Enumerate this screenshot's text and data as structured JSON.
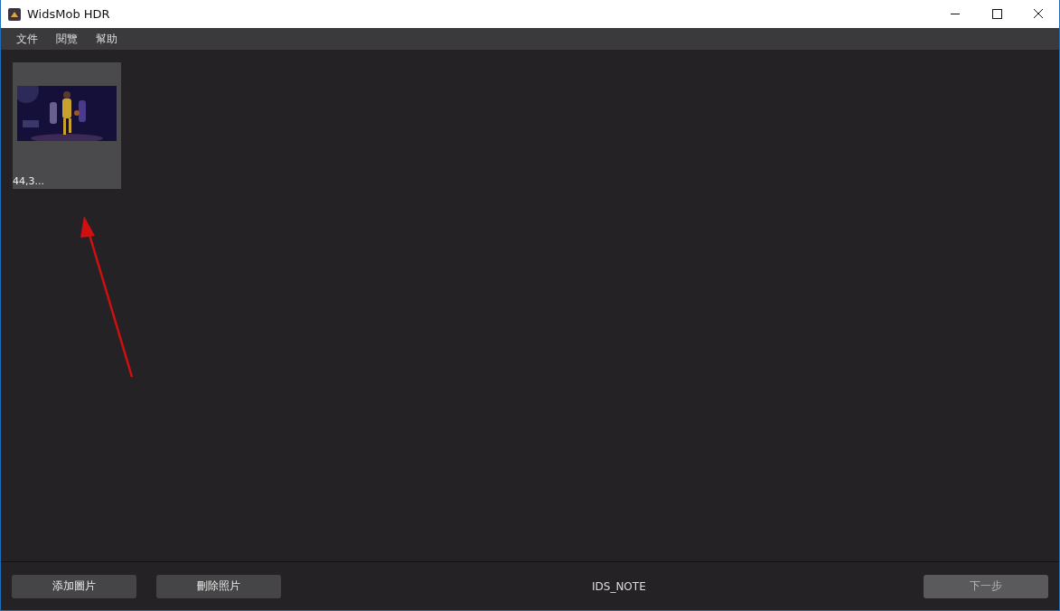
{
  "window": {
    "title": "WidsMob HDR"
  },
  "menu": [
    "文件",
    "閱覽",
    "幫助"
  ],
  "thumbnails": [
    {
      "kind": "picture",
      "label": "44,3...",
      "selected": true
    }
  ],
  "footer": {
    "buttons": [
      {
        "label": "添加圖片",
        "disabled": false
      },
      {
        "label": "刪除照片",
        "disabled": false
      }
    ],
    "note": "IDS_NOTE",
    "next": {
      "label": "下一步",
      "disabled": true
    }
  }
}
